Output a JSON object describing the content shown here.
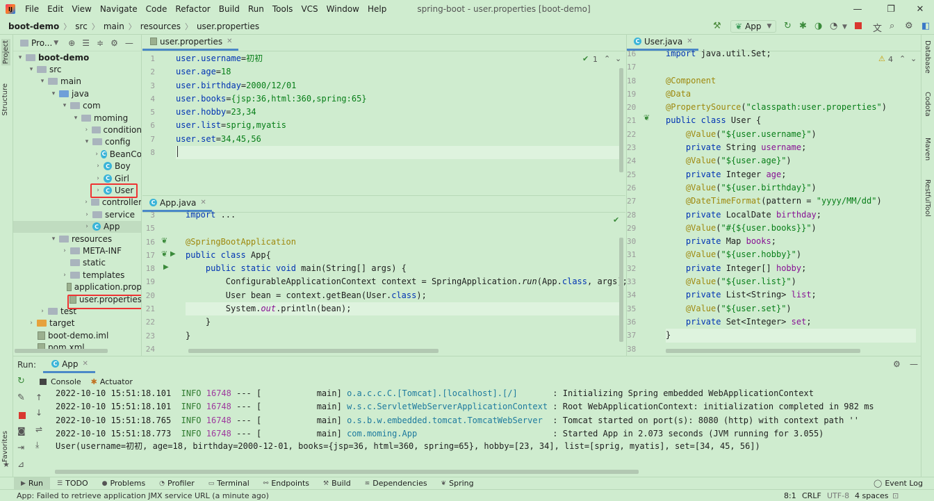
{
  "window": {
    "menu": [
      "File",
      "Edit",
      "View",
      "Navigate",
      "Code",
      "Refactor",
      "Build",
      "Run",
      "Tools",
      "VCS",
      "Window",
      "Help"
    ],
    "title": "spring-boot - user.properties [boot-demo]"
  },
  "breadcrumb": [
    "boot-demo",
    "src",
    "main",
    "resources",
    "user.properties"
  ],
  "toolbar": {
    "run_config": "App"
  },
  "side_tabs": {
    "left": [
      "Project",
      "Structure",
      "Favorites"
    ],
    "right": [
      "Database",
      "Codota",
      "Maven",
      "RestfulTool"
    ]
  },
  "project": {
    "header": "Pro...",
    "tree": [
      {
        "label": "boot-demo",
        "indent": 0,
        "arrow": "▾",
        "icon": "folder-grey",
        "bold": true
      },
      {
        "label": "src",
        "indent": 1,
        "arrow": "▾",
        "icon": "folder-grey"
      },
      {
        "label": "main",
        "indent": 2,
        "arrow": "▾",
        "icon": "folder-grey"
      },
      {
        "label": "java",
        "indent": 3,
        "arrow": "▾",
        "icon": "folder-blue"
      },
      {
        "label": "com",
        "indent": 4,
        "arrow": "▾",
        "icon": "folder-grey"
      },
      {
        "label": "moming",
        "indent": 5,
        "arrow": "▾",
        "icon": "folder-grey"
      },
      {
        "label": "condition",
        "indent": 6,
        "arrow": "›",
        "icon": "folder-grey"
      },
      {
        "label": "config",
        "indent": 6,
        "arrow": "▾",
        "icon": "folder-grey"
      },
      {
        "label": "BeanCo",
        "indent": 7,
        "arrow": "›",
        "icon": "class"
      },
      {
        "label": "Boy",
        "indent": 7,
        "arrow": "›",
        "icon": "class"
      },
      {
        "label": "Girl",
        "indent": 7,
        "arrow": "›",
        "icon": "class"
      },
      {
        "label": "User",
        "indent": 7,
        "arrow": "›",
        "icon": "class"
      },
      {
        "label": "controller",
        "indent": 6,
        "arrow": "›",
        "icon": "folder-grey"
      },
      {
        "label": "service",
        "indent": 6,
        "arrow": "›",
        "icon": "folder-grey"
      },
      {
        "label": "App",
        "indent": 6,
        "arrow": "›",
        "icon": "class",
        "selected": true
      },
      {
        "label": "resources",
        "indent": 3,
        "arrow": "▾",
        "icon": "folder-grey"
      },
      {
        "label": "META-INF",
        "indent": 4,
        "arrow": "›",
        "icon": "folder-grey"
      },
      {
        "label": "static",
        "indent": 4,
        "arrow": "",
        "icon": "folder-grey"
      },
      {
        "label": "templates",
        "indent": 4,
        "arrow": "›",
        "icon": "folder-grey"
      },
      {
        "label": "application.prop",
        "indent": 4,
        "arrow": "",
        "icon": "file"
      },
      {
        "label": "user.properties",
        "indent": 4,
        "arrow": "",
        "icon": "file"
      },
      {
        "label": "test",
        "indent": 2,
        "arrow": "›",
        "icon": "folder-grey"
      },
      {
        "label": "target",
        "indent": 1,
        "arrow": "›",
        "icon": "folder-orange"
      },
      {
        "label": "boot-demo.iml",
        "indent": 1,
        "arrow": "",
        "icon": "file"
      },
      {
        "label": "pom.xml",
        "indent": 1,
        "arrow": "",
        "icon": "file"
      }
    ]
  },
  "editor_properties": {
    "tab": "user.properties",
    "inspection": "1",
    "lines": [
      {
        "n": "1",
        "text": "user.username=初初"
      },
      {
        "n": "2",
        "text": "user.age=18"
      },
      {
        "n": "3",
        "text": "user.birthday=2000/12/01"
      },
      {
        "n": "4",
        "text": "user.books={jsp:36,html:360,spring:65}"
      },
      {
        "n": "5",
        "text": "user.hobby=23,34"
      },
      {
        "n": "6",
        "text": "user.list=sprig,myatis"
      },
      {
        "n": "7",
        "text": "user.set=34,45,56"
      },
      {
        "n": "8",
        "text": ""
      }
    ]
  },
  "editor_app": {
    "tab": "App.java",
    "lines": [
      {
        "n": "3",
        "html": "<span class='k'>import</span> ..."
      },
      {
        "n": "15",
        "html": ""
      },
      {
        "n": "16",
        "html": "<span class='an'>@SpringBootApplication</span>"
      },
      {
        "n": "17",
        "html": "<span class='k'>public class</span> App{"
      },
      {
        "n": "18",
        "html": "    <span class='k'>public static void</span> main(String[] args) {"
      },
      {
        "n": "19",
        "html": "        ConfigurableApplicationContext context = SpringApplication.<span class='itl'>run</span>(App.<span class='k'>class</span>, args);"
      },
      {
        "n": "20",
        "html": "        User bean = context.getBean(User.<span class='k'>class</span>);"
      },
      {
        "n": "21",
        "html": "        System.<span class='fld itl'>out</span>.println(bean);"
      },
      {
        "n": "22",
        "html": "    }"
      },
      {
        "n": "23",
        "html": "}"
      },
      {
        "n": "24",
        "html": ""
      }
    ]
  },
  "editor_user": {
    "tab": "User.java",
    "warnings": "4",
    "lines": [
      {
        "n": "16",
        "html": "<span class='k'>import</span> java.util.Set;"
      },
      {
        "n": "17",
        "html": ""
      },
      {
        "n": "18",
        "html": "<span class='an'>@Component</span>"
      },
      {
        "n": "19",
        "html": "<span class='an'>@Data</span>"
      },
      {
        "n": "20",
        "html": "<span class='an'>@PropertySource</span>(<span class='str'>\"classpath:user.properties\"</span>)"
      },
      {
        "n": "21",
        "html": "<span class='k'>public class</span> User {"
      },
      {
        "n": "22",
        "html": "    <span class='an'>@Value</span>(<span class='str'>\"${user.username}\"</span>)"
      },
      {
        "n": "23",
        "html": "    <span class='k'>private</span> String <span class='fld'>username</span>;"
      },
      {
        "n": "24",
        "html": "    <span class='an'>@Value</span>(<span class='str'>\"${user.age}\"</span>)"
      },
      {
        "n": "25",
        "html": "    <span class='k'>private</span> Integer <span class='fld'>age</span>;"
      },
      {
        "n": "26",
        "html": "    <span class='an'>@Value</span>(<span class='str'>\"${user.birthday}\"</span>)"
      },
      {
        "n": "27",
        "html": "    <span class='an'>@DateTimeFormat</span>(pattern = <span class='str'>\"yyyy/MM/dd\"</span>)"
      },
      {
        "n": "28",
        "html": "    <span class='k'>private</span> LocalDate <span class='fld'>birthday</span>;"
      },
      {
        "n": "29",
        "html": "    <span class='an'>@Value</span>(<span class='str'>\"#{${user.books}}\"</span>)"
      },
      {
        "n": "30",
        "html": "    <span class='k'>private</span> Map <span class='fld'>books</span>;"
      },
      {
        "n": "31",
        "html": "    <span class='an'>@Value</span>(<span class='str'>\"${user.hobby}\"</span>)"
      },
      {
        "n": "32",
        "html": "    <span class='k'>private</span> Integer[] <span class='fld'>hobby</span>;"
      },
      {
        "n": "33",
        "html": "    <span class='an'>@Value</span>(<span class='str'>\"${user.list}\"</span>)"
      },
      {
        "n": "34",
        "html": "    <span class='k'>private</span> List&lt;String&gt; <span class='fld'>list</span>;"
      },
      {
        "n": "35",
        "html": "    <span class='an'>@Value</span>(<span class='str'>\"${user.set}\"</span>)"
      },
      {
        "n": "36",
        "html": "    <span class='k'>private</span> Set&lt;Integer&gt; <span class='fld'>set</span>;"
      },
      {
        "n": "37",
        "html": "}"
      },
      {
        "n": "38",
        "html": ""
      }
    ]
  },
  "run": {
    "label": "Run:",
    "tab": "App",
    "subtabs": [
      "Console",
      "Actuator"
    ],
    "logs": [
      {
        "ts": "2022-10-10 15:51:18.101",
        "level": "INFO",
        "pid": "16748",
        "sep": "--- [",
        "thread": "main]",
        "cls": "o.a.c.c.C.[Tomcat].[localhost].[/]      ",
        "msg": ": Initializing Spring embedded WebApplicationContext"
      },
      {
        "ts": "2022-10-10 15:51:18.101",
        "level": "INFO",
        "pid": "16748",
        "sep": "--- [",
        "thread": "main]",
        "cls": "w.s.c.ServletWebServerApplicationContext",
        "msg": ": Root WebApplicationContext: initialization completed in 982 ms"
      },
      {
        "ts": "2022-10-10 15:51:18.765",
        "level": "INFO",
        "pid": "16748",
        "sep": "--- [",
        "thread": "main]",
        "cls": "o.s.b.w.embedded.tomcat.TomcatWebServer ",
        "msg": ": Tomcat started on port(s): 8080 (http) with context path ''"
      },
      {
        "ts": "2022-10-10 15:51:18.773",
        "level": "INFO",
        "pid": "16748",
        "sep": "--- [",
        "thread": "main]",
        "cls": "com.moming.App                          ",
        "msg": ": Started App in 2.073 seconds (JVM running for 3.055)"
      }
    ],
    "output": "User(username=初初, age=18, birthday=2000-12-01, books={jsp=36, html=360, spring=65}, hobby=[23, 34], list=[sprig, myatis], set=[34, 45, 56])"
  },
  "bottom_tabs": [
    "Run",
    "TODO",
    "Problems",
    "Profiler",
    "Terminal",
    "Endpoints",
    "Build",
    "Dependencies",
    "Spring"
  ],
  "event_log": "Event Log",
  "status": {
    "message": "App: Failed to retrieve application JMX service URL (a minute ago)",
    "position": "8:1",
    "line_sep": "CRLF",
    "encoding": "UTF-8",
    "indent": "4 spaces"
  }
}
